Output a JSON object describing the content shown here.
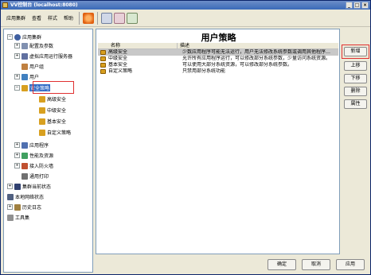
{
  "window": {
    "title": "VV控制台 (localhost:8080)"
  },
  "menu": [
    "应用集群",
    "查看",
    "样式",
    "帮助"
  ],
  "tree": {
    "root": "应用集群",
    "items": [
      "配置及参数",
      "虚拟应用运行服务器",
      "用户组",
      "用户",
      "安全策略",
      "高级安全",
      "中级安全",
      "基本安全",
      "自定义策略",
      "应用程序",
      "性能及资源",
      "接入防火墙",
      "通用打印",
      "集群当前状态",
      "本地网络状态",
      "历史日志",
      "工具集"
    ]
  },
  "main": {
    "title": "用户策略",
    "columns": [
      "名称",
      "描述"
    ],
    "rows": [
      {
        "name": "高级安全",
        "desc": "少数应用程序可能无法运行，用户无法修改系统参数或调用其他程序…"
      },
      {
        "name": "中级安全",
        "desc": "允许所有应用程序运行，可以修改部分系统参数，少量访问系统资源。"
      },
      {
        "name": "基本安全",
        "desc": "可以使用大部分系统资源，可以修改部分系统参数。"
      },
      {
        "name": "自定义策略",
        "desc": "只禁用部分系统功能"
      }
    ]
  },
  "side_buttons": {
    "new": "新增",
    "up": "上移",
    "down": "下移",
    "delete": "删除",
    "props": "属性"
  },
  "bottom_buttons": {
    "ok": "确定",
    "cancel": "取消",
    "apply": "应用"
  },
  "colors": {
    "selection": "#316ac5",
    "highlight": "#e03030",
    "titlebar": "#3a6ab8"
  }
}
